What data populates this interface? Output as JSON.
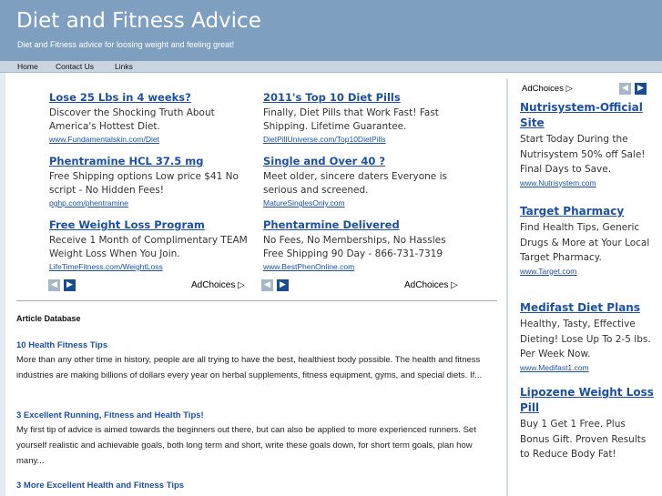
{
  "header": {
    "title": "Diet and Fitness Advice",
    "tagline": "Diet and Fitness advice for loosing weight and feeling great!"
  },
  "nav": {
    "items": [
      "Home",
      "Contact Us",
      "Links"
    ]
  },
  "ad_units": [
    {
      "ads": [
        {
          "title": "Lose 25 Lbs in 4 weeks?",
          "desc": "Discover the Shocking Truth About America's Hottest Diet.",
          "url": "www.Fundamentalskin.com/Diet"
        },
        {
          "title": "Phentramine HCL 37.5 mg",
          "desc": "Free Shipping options Low price $41 No script - No Hidden Fees!",
          "url": "pghp.com/phentramine"
        },
        {
          "title": "Free Weight Loss Program",
          "desc": "Receive 1 Month of Complimentary TEAM Weight Loss When You Join.",
          "url": "LifeTimeFitness.com/WeightLoss"
        }
      ],
      "adchoices": "AdChoices"
    },
    {
      "ads": [
        {
          "title": "2011's Top 10 Diet Pills",
          "desc": "Finally, Diet Pills that Work Fast! Fast Shipping. Lifetime Guarantee.",
          "url": "DietPillUniverse.com/Top10DietPills"
        },
        {
          "title": "Single and Over 40 ?",
          "desc": "Meet older, sincere daters Everyone is serious and screened.",
          "url": "MatureSinglesOnly.com"
        },
        {
          "title": "Phentarmine Delivered",
          "desc": "No Fees, No Memberships, No Hassles Free Shipping 90 Day - 866-731-7319",
          "url": "www.BestPhenOnline.com"
        }
      ],
      "adchoices": "AdChoices"
    }
  ],
  "articles": {
    "heading": "Article Database",
    "items": [
      {
        "title": "10 Health Fitness Tips",
        "excerpt": "More than any other time in history, people are all trying to have the best, healthiest body possible. The health and fitness industries are making billions of dollars every year on herbal supplements, fitness equipment, gyms, and special diets. If..."
      },
      {
        "title": "3 Excellent Running, Fitness and Health Tips!",
        "excerpt": "My first tip of advice is aimed towards the beginners out there, but can also be applied to more experienced runners. Set yourself realistic and achievable goals, both long term and short, write these goals down, for short term goals, plan how many..."
      },
      {
        "title": "3 More Excellent Health and Fitness Tips",
        "excerpt": ""
      }
    ]
  },
  "sidebar": {
    "adchoices": "AdChoices",
    "ads": [
      {
        "title": "Nutrisystem-Official Site",
        "desc": "Start Today During the Nutrisystem 50% off Sale! Final Days to Save.",
        "url": "www.Nutrisystem.com"
      },
      {
        "title": "Target Pharmacy",
        "desc": "Find Health Tips, Generic Drugs & More at Your Local Target Pharmacy.",
        "url": "www.Target.com"
      },
      {
        "title": "Medifast Diet Plans",
        "desc": "Healthy, Tasty, Effective Dieting! Lose Up To 2-5 lbs. Per Week Now.",
        "url": "www.Medifast1.com"
      },
      {
        "title": "Lipozene Weight Loss Pill",
        "desc": "Buy 1 Get 1 Free. Plus Bonus Gift. Proven Results to Reduce Body Fat!",
        "url": ""
      }
    ]
  },
  "icons": {
    "prev": "◀",
    "next": "▶",
    "adchoices": "▷"
  },
  "colors": {
    "header_bg": "#7e9fbf",
    "link": "#1e50a0",
    "nav_bg": "#c8d4e0"
  }
}
